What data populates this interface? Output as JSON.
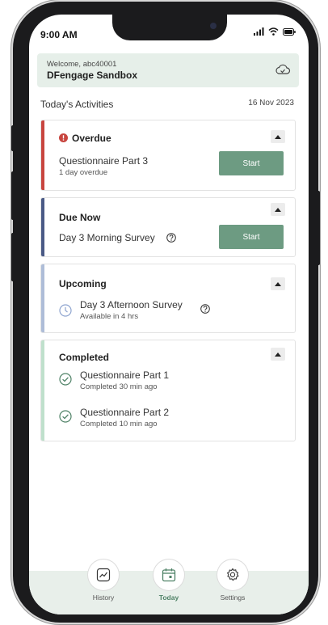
{
  "status_bar": {
    "time": "9:00 AM"
  },
  "header": {
    "welcome": "Welcome, abc40001",
    "app_name": "DFengage Sandbox",
    "cloud_icon": "cloud-sync-icon"
  },
  "section": {
    "title": "Today's Activities",
    "date": "16 Nov 2023"
  },
  "overdue": {
    "title": "Overdue",
    "item": {
      "title": "Questionnaire Part 3",
      "subtitle": "1 day overdue",
      "button": "Start"
    }
  },
  "due_now": {
    "title": "Due Now",
    "item": {
      "title": "Day 3 Morning Survey",
      "button": "Start"
    }
  },
  "upcoming": {
    "title": "Upcoming",
    "item": {
      "title": "Day 3 Afternoon Survey",
      "subtitle": "Available in 4 hrs"
    }
  },
  "completed": {
    "title": "Completed",
    "items": [
      {
        "title": "Questionnaire Part 1",
        "subtitle": "Completed 30 min ago"
      },
      {
        "title": "Questionnaire Part 2",
        "subtitle": "Completed 10 min ago"
      }
    ]
  },
  "tabs": [
    {
      "label": "History",
      "icon": "chart-line-icon"
    },
    {
      "label": "Today",
      "icon": "calendar-icon"
    },
    {
      "label": "Settings",
      "icon": "gear-icon"
    }
  ],
  "colors": {
    "accent": "#6d9b82",
    "overdue": "#c8453f",
    "due_now": "#4a5a86",
    "upcoming": "#aebdd8",
    "completed": "#bfe0cc"
  }
}
